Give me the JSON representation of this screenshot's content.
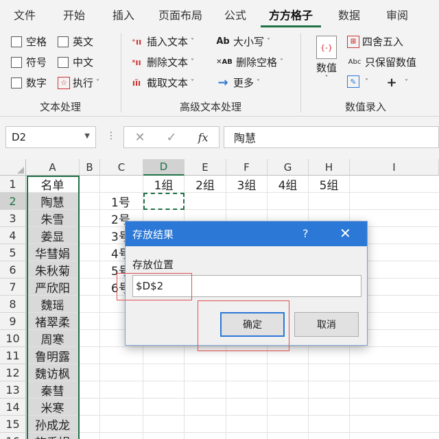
{
  "tabs": [
    {
      "label": "文件"
    },
    {
      "label": "开始"
    },
    {
      "label": "插入"
    },
    {
      "label": "页面布局"
    },
    {
      "label": "公式"
    },
    {
      "label": "方方格子"
    },
    {
      "label": "数据"
    },
    {
      "label": "审阅"
    }
  ],
  "active_tab": "方方格子",
  "ribbon": {
    "text_group": {
      "label": "文本处理",
      "checkboxes": [
        "空格",
        "英文",
        "符号",
        "中文",
        "数字"
      ],
      "execute": "执行"
    },
    "advanced_group": {
      "label": "高级文本处理",
      "case_icon": "Ab",
      "space_icon": "✕AB",
      "items": [
        "插入文本",
        "删除文本",
        "截取文本",
        "大小写",
        "删除空格",
        "更多"
      ]
    },
    "numeric_group": {
      "label": "数值录入",
      "value_button": "数值",
      "round": "四舍五入",
      "keep_icon": "Abc",
      "keep_values": "只保留数值"
    }
  },
  "formula_bar": {
    "name_box": "D2",
    "fx": "fx",
    "cancel_icon": "✕",
    "confirm_icon": "✓",
    "formula": "陶慧"
  },
  "grid": {
    "columns": [
      "A",
      "B",
      "C",
      "D",
      "E",
      "F",
      "G",
      "H",
      "I"
    ],
    "selected_column": "D",
    "rows": [
      "1",
      "2",
      "3",
      "4",
      "5",
      "6",
      "7",
      "8",
      "9",
      "10",
      "11",
      "12",
      "13",
      "14",
      "15",
      "16"
    ],
    "selected_row": "2",
    "header_a1": "名单",
    "names": [
      "陶慧",
      "朱雪",
      "姜显",
      "华彗娟",
      "朱秋菊",
      "严欣阳",
      "魏瑶",
      "褚翠柔",
      "周寒",
      "鲁明露",
      "魏访枫",
      "秦彗",
      "米寒",
      "孙成龙",
      "施秀娟"
    ],
    "c_col": [
      "1号",
      "2号",
      "3号",
      "4号",
      "5号",
      "6号"
    ],
    "group_headers": [
      "1组",
      "2组",
      "3组",
      "4组",
      "5组"
    ]
  },
  "dialog": {
    "title": "存放结果",
    "help": "?",
    "close": "✕",
    "field_label": "存放位置",
    "field_value": "$D$2",
    "ok": "确定",
    "cancel": "取消"
  },
  "colors": {
    "excel_green": "#1e7145",
    "dialog_title_bg": "#2b78d6",
    "highlight_red": "#e05050",
    "name_fill": "#d9d9d9"
  }
}
